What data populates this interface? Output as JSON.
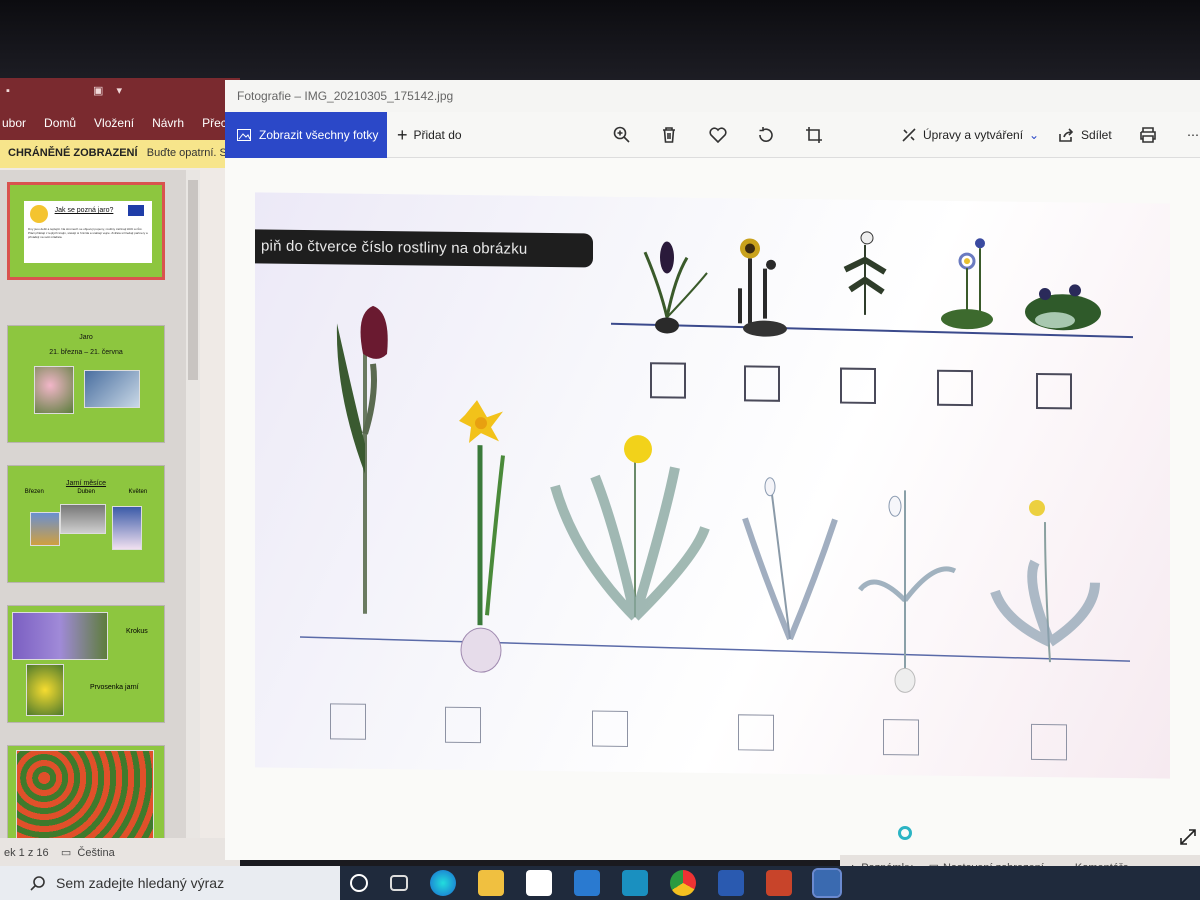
{
  "powerpoint": {
    "tabs": [
      "ubor",
      "Domů",
      "Vložení",
      "Návrh",
      "Přec"
    ],
    "protected_label": "CHRÁNĚNÉ ZOBRAZENÍ",
    "protected_text": "Buďte opatrní. S",
    "slides": [
      {
        "title": "Jak se pozná jaro?",
        "body": "Dny jsou delší a teplejší. Na stromech se objevují pupeny, rostliny začínají klíčit a růst. Ptáci přilétají z teplých krajin, stavějí si hnízda a snášejí vejce. Zvířata si hledají partnery a přivádějí na svět mláďata."
      },
      {
        "title": "Jaro",
        "subtitle": "21. března – 21. června"
      },
      {
        "title": "Jarní měsíce",
        "months": [
          "Březen",
          "Duben",
          "Květen"
        ]
      },
      {
        "labels": [
          "Krokus",
          "Prvosenka jarní"
        ]
      },
      {}
    ],
    "status_slide": "ek 1 z 16",
    "status_lang": "Čeština"
  },
  "photos": {
    "window_title": "Fotografie – IMG_20210305_175142.jpg",
    "btn_all": "Zobrazit všechny fotky",
    "btn_add": "Přidat do",
    "btn_edit": "Úpravy a vytváření",
    "btn_share": "Sdílet",
    "worksheet_banner": "piň do čtverce číslo rostliny na obrázku"
  },
  "ppt_status_right": {
    "notes": "Poznámky",
    "view_settings": "Nastavení zobrazení",
    "comments": "Komentáře"
  },
  "taskbar": {
    "search_placeholder": "Sem zadejte hledaný výraz"
  },
  "colors": {
    "accent_blue": "#2b48c8",
    "ppt_red": "#7a2a2f",
    "slide_green": "#8dc63f",
    "protected_yellow": "#f7e58b"
  }
}
